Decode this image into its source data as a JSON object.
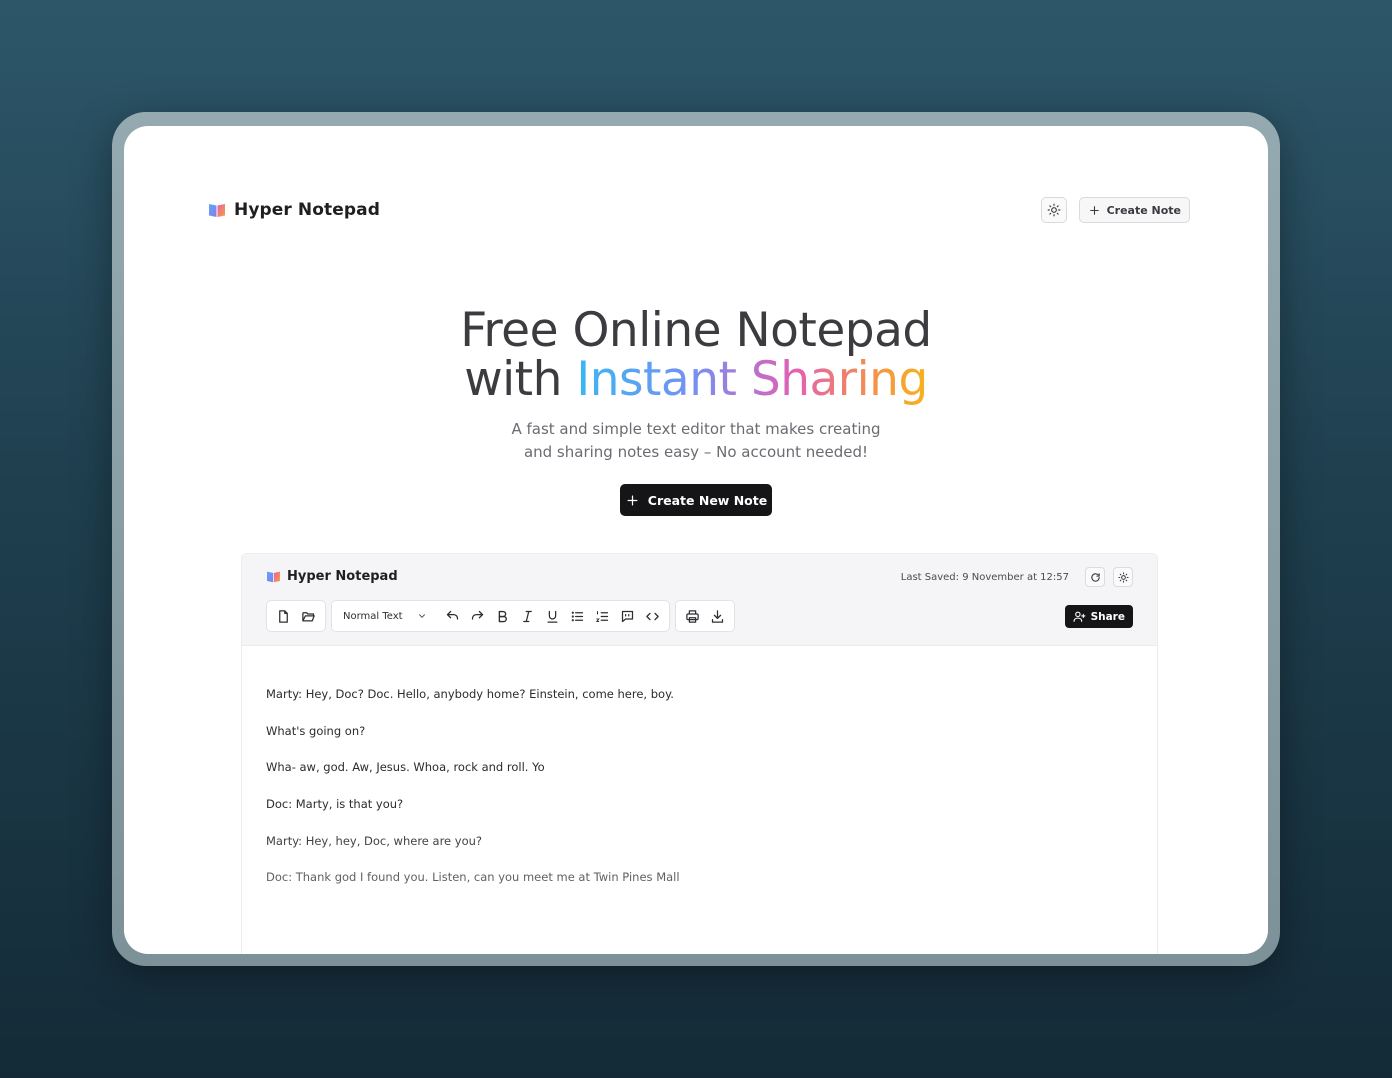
{
  "nav": {
    "title": "Hyper Notepad",
    "theme_icon": "sun-icon",
    "create_note_label": "Create Note"
  },
  "hero": {
    "title_line1": "Free Online Notepad",
    "title_with": "with",
    "title_highlight": "Instant Sharing",
    "subtitle_line1": "A fast and simple text editor that makes creating",
    "subtitle_line2": "and sharing notes easy – No account needed!",
    "cta_label": "Create New Note"
  },
  "editor": {
    "title": "Hyper Notepad",
    "last_saved": "Last Saved: 9 November at 12:57",
    "text_style": "Normal Text",
    "share_label": "Share",
    "toolbar_icons": [
      "new-file-icon",
      "open-folder-icon",
      "undo-icon",
      "redo-icon",
      "bold-icon",
      "italic-icon",
      "underline-icon",
      "bullet-list-icon",
      "numbered-list-icon",
      "quote-icon",
      "code-icon",
      "print-icon",
      "download-icon"
    ],
    "lines": [
      "Marty: Hey, Doc? Doc. Hello, anybody home? Einstein, come here, boy.",
      "What's going on?",
      "Wha- aw, god. Aw, Jesus. Whoa, rock and roll. Yo",
      "Doc: Marty, is that you?",
      "Marty: Hey, hey, Doc, where are you?",
      "Doc: Thank god I found you. Listen, can you meet me at Twin Pines Mall"
    ]
  },
  "colors": {
    "background_top": "#2d5769",
    "background_bottom": "#142b37",
    "button_dark": "#151517",
    "gradient_start": "#38b8f2",
    "gradient_mid": "#e45fb4",
    "gradient_end": "#f6b31e"
  }
}
